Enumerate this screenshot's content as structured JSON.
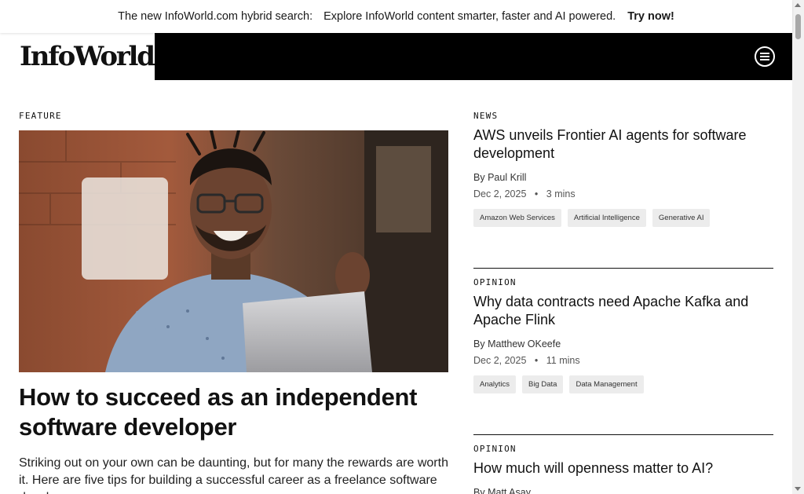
{
  "promo": {
    "lead": "The new InfoWorld.com hybrid search:",
    "body": "Explore InfoWorld content smarter, faster and AI powered.",
    "cta": "Try now!"
  },
  "header": {
    "logo_text": "InfoWorld",
    "menu_icon": "menu-circle-icon"
  },
  "feature": {
    "label": "FEATURE",
    "image_icon": "photo-man-laptop",
    "title": "How to succeed as an independent software developer",
    "summary": "Striking out on your own can be daunting, but for many the rewards are worth it. Here are five tips for building a successful career as a freelance software developer."
  },
  "articles": [
    {
      "label": "NEWS",
      "title": "AWS unveils Frontier AI agents for software development",
      "by": "By",
      "author": "Paul Krill",
      "date": "Dec 2, 2025",
      "sep": "•",
      "read": "3 mins",
      "tags": [
        "Amazon Web Services",
        "Artificial Intelligence",
        "Generative AI"
      ]
    },
    {
      "label": "OPINION",
      "title": "Why data contracts need Apache Kafka and Apache Flink",
      "by": "By",
      "author": "Matthew OKeefe",
      "date": "Dec 2, 2025",
      "sep": "•",
      "read": "11 mins",
      "tags": [
        "Analytics",
        "Big Data",
        "Data Management"
      ]
    },
    {
      "label": "OPINION",
      "title": "How much will openness matter to AI?",
      "by": "By",
      "author": "Matt Asay"
    }
  ],
  "colors": {
    "nav_bg": "#000000",
    "tag_bg": "#ececec",
    "text": "#111111"
  }
}
